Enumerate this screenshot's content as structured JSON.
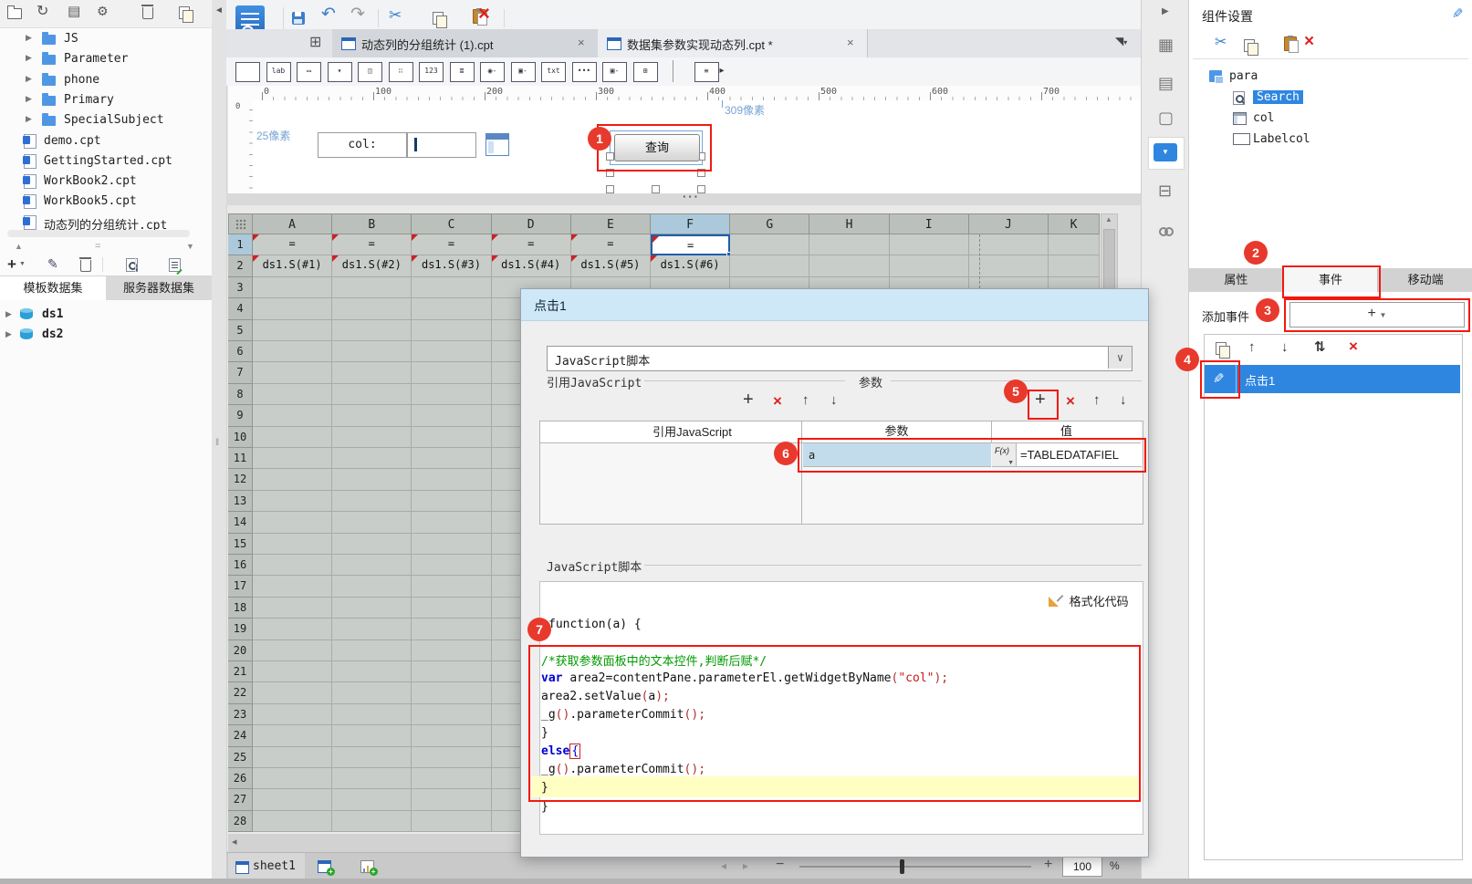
{
  "colors": {
    "annotation_red": "#e8392d",
    "highlight_red": "#f2190f",
    "selection_blue": "#2f86e0",
    "accent_blue": "#2f81d8",
    "label_blue": "#7aa3d6"
  },
  "left_panel": {
    "toolbar": [
      {
        "name": "new-folder"
      },
      {
        "name": "refresh"
      },
      {
        "name": "preview-panel"
      },
      {
        "name": "template-settings"
      },
      {
        "name": "delete"
      },
      {
        "name": "copy"
      }
    ],
    "folders": [
      "JS",
      "Parameter",
      "phone",
      "Primary",
      "SpecialSubject"
    ],
    "files": [
      "demo.cpt",
      "GettingStarted.cpt",
      "WorkBook2.cpt",
      "WorkBook5.cpt",
      "动态列的分组统计.cpt"
    ],
    "dataset_toolbar": [
      {
        "name": "add-dataset"
      },
      {
        "name": "edit-dataset"
      },
      {
        "name": "delete-dataset"
      },
      {
        "name": "preview-dataset"
      },
      {
        "name": "edit-sql"
      }
    ],
    "dataset_tabs": [
      {
        "label": "模板数据集",
        "active": true
      },
      {
        "label": "服务器数据集",
        "active": false
      }
    ],
    "datasets": [
      "ds1",
      "ds2"
    ]
  },
  "main_toolbar": [
    {
      "name": "save"
    },
    {
      "name": "undo"
    },
    {
      "name": "redo"
    },
    {
      "name": "cut"
    },
    {
      "name": "copy"
    },
    {
      "name": "paste"
    },
    {
      "name": "delete"
    }
  ],
  "doc_tabs": [
    {
      "label": "动态列的分组统计 (1).cpt"
    },
    {
      "label": "数据集参数实现动态列.cpt *"
    }
  ],
  "widget_toolbar": [
    "textfield",
    "label",
    "button",
    "combobox",
    "window",
    "date",
    "number",
    "list",
    "radio-group",
    "checkbox-group",
    "textarea",
    "password",
    "checkbox",
    "tree",
    "separator",
    "query"
  ],
  "ruler": {
    "labels": [
      "0",
      "100",
      "200",
      "300",
      "400",
      "500",
      "600",
      "700"
    ],
    "v_origin": "0"
  },
  "param_pane": {
    "height_label": "25像素",
    "width_label": "309像素",
    "field_label": "col:",
    "query_button": "查询"
  },
  "grid": {
    "columns": [
      "A",
      "B",
      "C",
      "D",
      "E",
      "F",
      "G",
      "H",
      "I",
      "J",
      "K"
    ],
    "selected_column": "F",
    "selected_row": 1,
    "rows": 28,
    "row1": [
      "=",
      "=",
      "=",
      "=",
      "=",
      "="
    ],
    "row2": [
      "ds1.S(#1)",
      "ds1.S(#2)",
      "ds1.S(#3)",
      "ds1.S(#4)",
      "ds1.S(#5)",
      "ds1.S(#6)"
    ]
  },
  "dialog": {
    "title": "点击1",
    "event_type": "JavaScript脚本",
    "ref_section_label": "引用JavaScript",
    "param_section_label": "参数",
    "ref_table_header": "引用JavaScript",
    "param_table": {
      "param_header": "参数",
      "value_header": "值",
      "row": {
        "name": "a",
        "fx_label": "F(x)",
        "value": "=TABLEDATAFIEL"
      }
    },
    "script_section_label": "JavaScript脚本",
    "function_line": "function(a) {",
    "format_button": "格式化代码",
    "code_lines": [
      {
        "highlight": false,
        "segments": [
          {
            "text": "/*获取参数面板中的文本控件,判断后赋*/",
            "style": "comment"
          }
        ]
      },
      {
        "highlight": false,
        "segments": [
          {
            "text": "var ",
            "style": "keyword"
          },
          {
            "text": "area2=contentPane.parameterEl.getWidgetByName",
            "style": "plain"
          },
          {
            "text": "(",
            "style": "paren"
          },
          {
            "text": "\"col\"",
            "style": "string"
          },
          {
            "text": ");",
            "style": "paren"
          }
        ]
      },
      {
        "highlight": false,
        "segments": [
          {
            "text": "area2.setValue",
            "style": "plain"
          },
          {
            "text": "(",
            "style": "paren"
          },
          {
            "text": "a",
            "style": "plain"
          },
          {
            "text": ");",
            "style": "paren"
          }
        ]
      },
      {
        "highlight": false,
        "segments": [
          {
            "text": "_g",
            "style": "plain"
          },
          {
            "text": "()",
            "style": "paren"
          },
          {
            "text": ".parameterCommit",
            "style": "plain"
          },
          {
            "text": "();",
            "style": "paren"
          }
        ]
      },
      {
        "highlight": false,
        "segments": [
          {
            "text": "}",
            "style": "plain"
          }
        ]
      },
      {
        "highlight": false,
        "segments": [
          {
            "text": "else",
            "style": "keyword"
          },
          {
            "text": "{",
            "style": "bracket"
          }
        ]
      },
      {
        "highlight": false,
        "segments": [
          {
            "text": "_g",
            "style": "plain"
          },
          {
            "text": "()",
            "style": "paren"
          },
          {
            "text": ".parameterCommit",
            "style": "plain"
          },
          {
            "text": "();",
            "style": "paren"
          }
        ]
      },
      {
        "highlight": true,
        "segments": [
          {
            "text": "}",
            "style": "plain"
          }
        ]
      }
    ],
    "trailing_line": "}"
  },
  "side_strip": [
    {
      "name": "collapse"
    },
    {
      "name": "report-blocks"
    },
    {
      "name": "report-info"
    },
    {
      "name": "frame"
    },
    {
      "name": "dropdown-active"
    },
    {
      "name": "layers"
    },
    {
      "name": "link"
    }
  ],
  "right_panel": {
    "title": "组件设置",
    "toolbar": [
      {
        "name": "cut"
      },
      {
        "name": "copy"
      },
      {
        "name": "paste"
      },
      {
        "name": "delete"
      }
    ],
    "tree": [
      {
        "label": "para",
        "icon": "container-icon",
        "selected": false,
        "level": 0
      },
      {
        "label": "Search",
        "icon": "search-widget-icon",
        "selected": true,
        "level": 1
      },
      {
        "label": "col",
        "icon": "text-widget-icon",
        "selected": false,
        "level": 1
      },
      {
        "label": "Labelcol",
        "icon": "label-widget-icon",
        "selected": false,
        "level": 1
      }
    ],
    "tabs": [
      {
        "label": "属性",
        "active": false
      },
      {
        "label": "事件",
        "active": true
      },
      {
        "label": "移动端",
        "active": false
      }
    ],
    "add_event_label": "添加事件",
    "event_toolbar": [
      {
        "name": "copy"
      },
      {
        "name": "move-up"
      },
      {
        "name": "move-down"
      },
      {
        "name": "sort"
      },
      {
        "name": "delete"
      }
    ],
    "events": [
      {
        "label": "点击1",
        "selected": true
      }
    ]
  },
  "status_bar": {
    "sheet_tab": "sheet1",
    "zoom_value": "100",
    "percent_label": "%"
  },
  "annotations": [
    "1",
    "2",
    "3",
    "4",
    "5",
    "6",
    "7"
  ]
}
